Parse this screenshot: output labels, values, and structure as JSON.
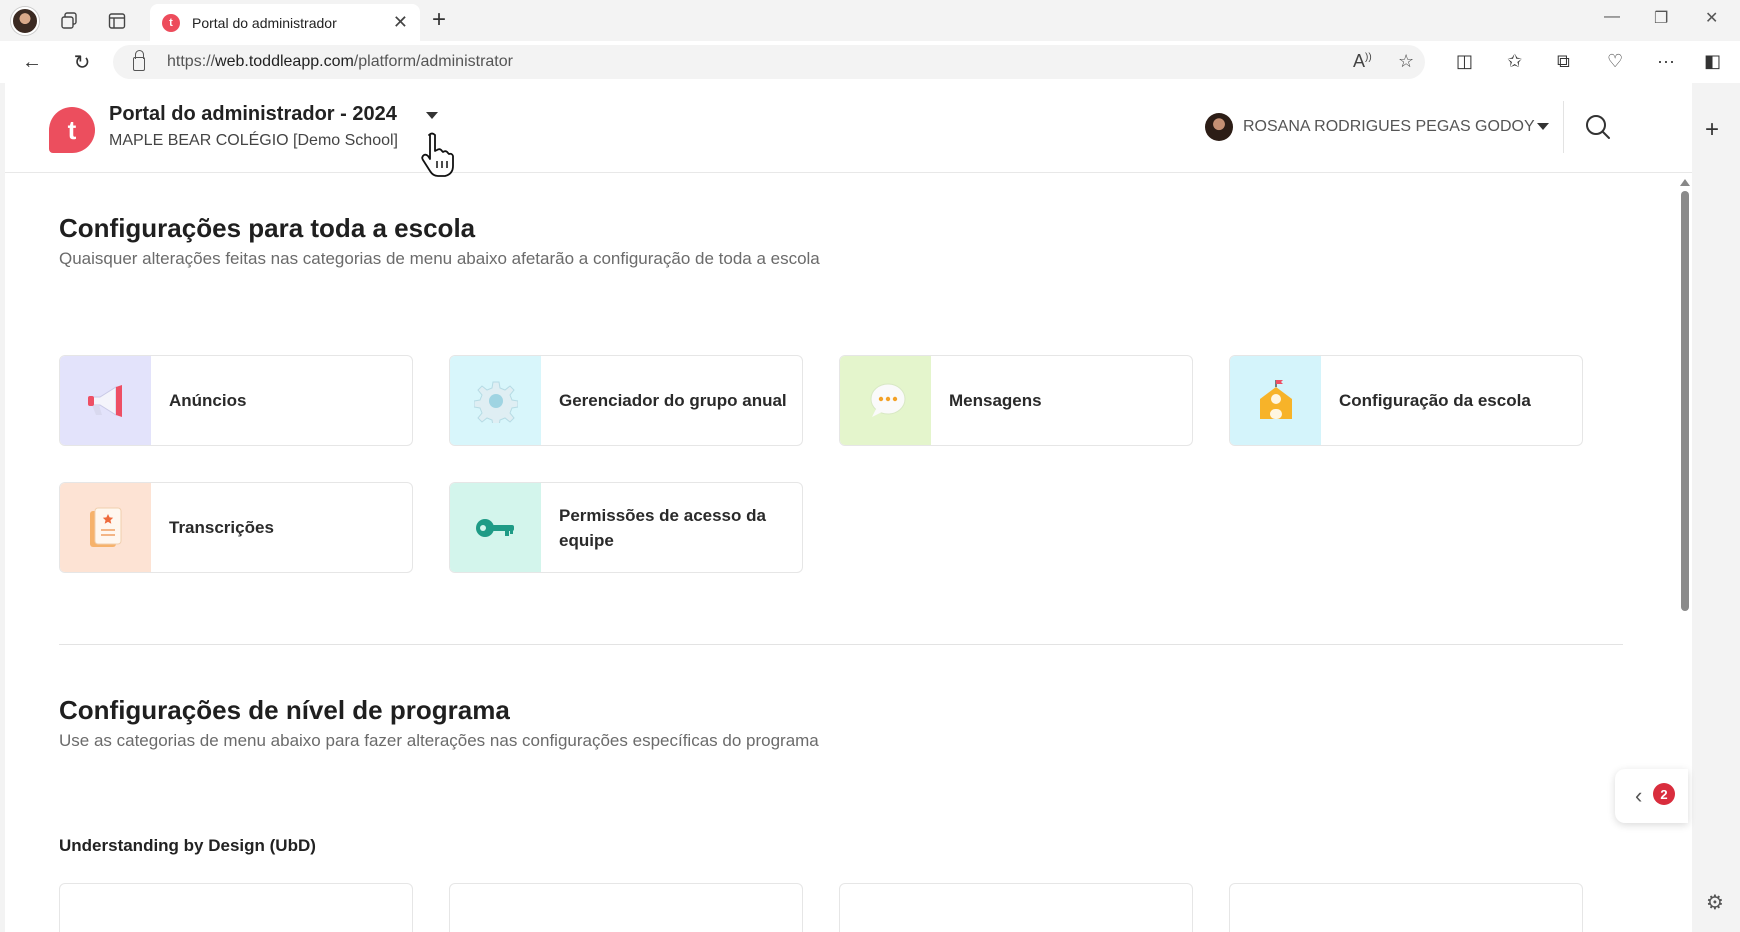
{
  "browser": {
    "tab_title": "Portal do administrador",
    "tab_favicon_letter": "t",
    "url_prefix": "https://",
    "url_host": "web.toddleapp.com",
    "url_path": "/platform/administrator"
  },
  "header": {
    "logo_letter": "t",
    "portal_title": "Portal do administrador - 2024",
    "school_name": "MAPLE BEAR COLÉGIO [Demo School]",
    "user_name": "ROSANA RODRIGUES PEGAS GODOY"
  },
  "school_settings": {
    "title": "Configurações para toda a escola",
    "subtitle": "Quaisquer alterações feitas nas categorias de menu abaixo afetarão a configuração de toda a escola",
    "cards": [
      {
        "label": "Anúncios",
        "icon": "megaphone-icon",
        "bg": "#e3e3fb"
      },
      {
        "label": "Gerenciador do grupo anual",
        "icon": "gear-icon",
        "bg": "#d8f6fb"
      },
      {
        "label": "Mensagens",
        "icon": "chat-bubble-icon",
        "bg": "#e4f5cc"
      },
      {
        "label": "Configuração da escola",
        "icon": "school-building-icon",
        "bg": "#d4f4fb"
      },
      {
        "label": "Transcrições",
        "icon": "transcript-document-icon",
        "bg": "#fde3d4"
      },
      {
        "label": "Permissões de acesso da equipe",
        "icon": "key-icon",
        "bg": "#d3f5ec"
      }
    ]
  },
  "program_settings": {
    "title": "Configurações de nível de programa",
    "subtitle": "Use as categorias de menu abaixo para fazer alterações nas configurações específicas do programa",
    "program_label": "Understanding by Design (UbD)"
  },
  "floating": {
    "badge_count": "2"
  }
}
